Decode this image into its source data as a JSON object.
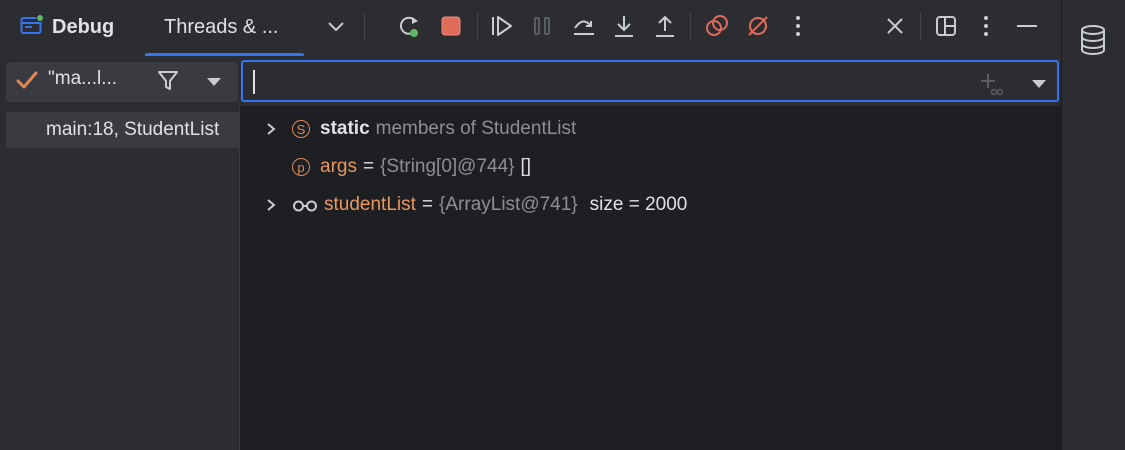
{
  "toolbar": {
    "debug_label": "Debug",
    "threads_label": "Threads & ...",
    "colors": {
      "accent": "#3574f0",
      "resume": "#5fb865",
      "stop": "#e06c5c",
      "step": "#c9ccd1"
    }
  },
  "frames_panel": {
    "thread_label": "\"ma...l...",
    "frames": [
      {
        "label": "main:18, StudentList"
      }
    ]
  },
  "evaluate": {
    "value": "",
    "placeholder": ""
  },
  "variables": [
    {
      "kind": "static",
      "badge": "S",
      "name": "static",
      "suffix": "members of StudentList",
      "expandable": true
    },
    {
      "kind": "param",
      "badge": "p",
      "name": "args",
      "eq": "=",
      "ref": "{String[0]@744}",
      "value": "[]",
      "expandable": false
    },
    {
      "kind": "watch",
      "name": "studentList",
      "eq": "=",
      "ref": "{ArrayList@741}",
      "value": "size = 2000",
      "expandable": true
    }
  ]
}
